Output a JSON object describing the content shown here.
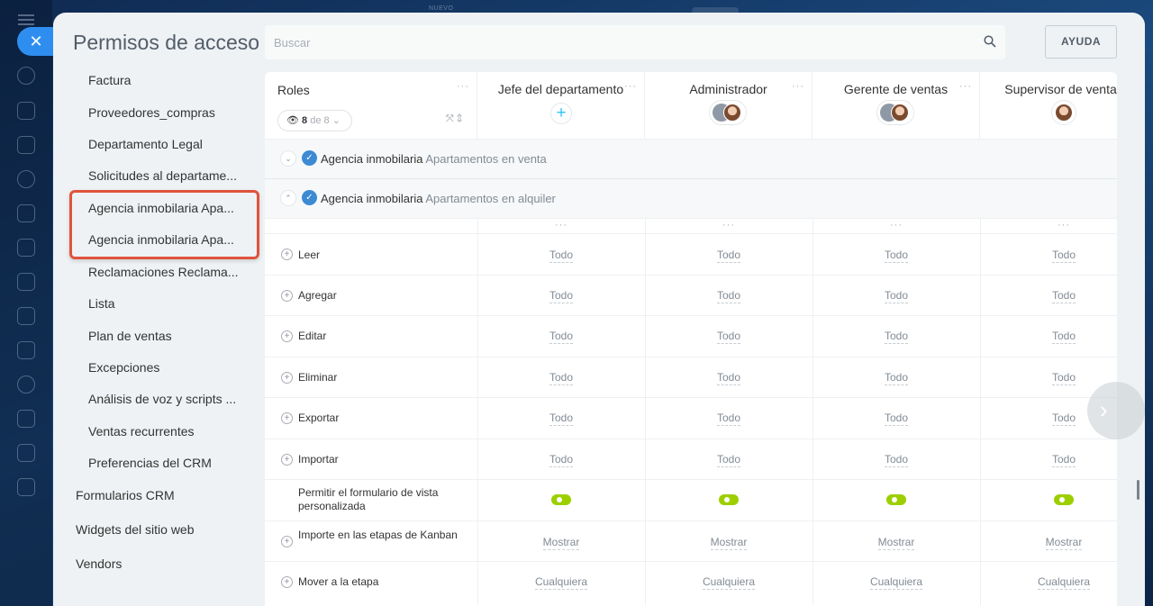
{
  "top_faint_text": "NUEVO",
  "header": {
    "title": "Permisos de acceso",
    "search_placeholder": "Buscar",
    "help_label": "AYUDA",
    "close_symbol": "✕"
  },
  "menu": {
    "sub_items": [
      "Factura",
      "Proveedores_compras",
      "Departamento Legal",
      "Solicitudes al departame...",
      "Agencia inmobilaria Apa...",
      "Agencia inmobilaria Apa...",
      "Reclamaciones Reclama...",
      "Lista",
      "Plan de ventas",
      "Excepciones",
      "Análisis de voz y scripts ...",
      "Ventas recurrentes",
      "Preferencias del CRM"
    ],
    "top_items": [
      "Formularios CRM",
      "Widgets del sitio web",
      "Vendors"
    ],
    "highlight_color": "#e0533c"
  },
  "table": {
    "roles_label": "Roles",
    "roles_filter": {
      "count": "8",
      "of_text": "de 8",
      "icon": "eye-icon"
    },
    "columns": [
      {
        "title": "Jefe del departamento",
        "avatar": "add-plus"
      },
      {
        "title": "Administrador",
        "avatar": "group-and-person"
      },
      {
        "title": "Gerente de ventas",
        "avatar": "group-and-person"
      },
      {
        "title": "Supervisor de ventas",
        "avatar": "person"
      }
    ],
    "sections": [
      {
        "entity": "Agencia inmobilaria",
        "name": "Apartamentos en venta",
        "expanded": false
      },
      {
        "entity": "Agencia inmobilaria",
        "name": "Apartamentos en alquiler",
        "expanded": true
      }
    ],
    "permission_rows": [
      {
        "label": "Leer",
        "values": [
          "Todo",
          "Todo",
          "Todo",
          "Todo"
        ]
      },
      {
        "label": "Agregar",
        "values": [
          "Todo",
          "Todo",
          "Todo",
          "Todo"
        ]
      },
      {
        "label": "Editar",
        "values": [
          "Todo",
          "Todo",
          "Todo",
          "Todo"
        ]
      },
      {
        "label": "Eliminar",
        "values": [
          "Todo",
          "Todo",
          "Todo",
          "Todo"
        ]
      },
      {
        "label": "Exportar",
        "values": [
          "Todo",
          "Todo",
          "Todo",
          "Todo"
        ]
      },
      {
        "label": "Importar",
        "values": [
          "Todo",
          "Todo",
          "Todo",
          "Todo"
        ]
      },
      {
        "label": "Permitir el formulario de vista personalizada",
        "toggle": true
      },
      {
        "label": "Importe en las etapas de Kanban",
        "values": [
          "Mostrar",
          "Mostrar",
          "Mostrar",
          "Mostrar"
        ]
      },
      {
        "label": "Mover a la etapa",
        "values": [
          "Cualquiera",
          "Cualquiera",
          "Cualquiera",
          "Cualquiera"
        ]
      }
    ],
    "toggle_color": "#9dcf00"
  }
}
